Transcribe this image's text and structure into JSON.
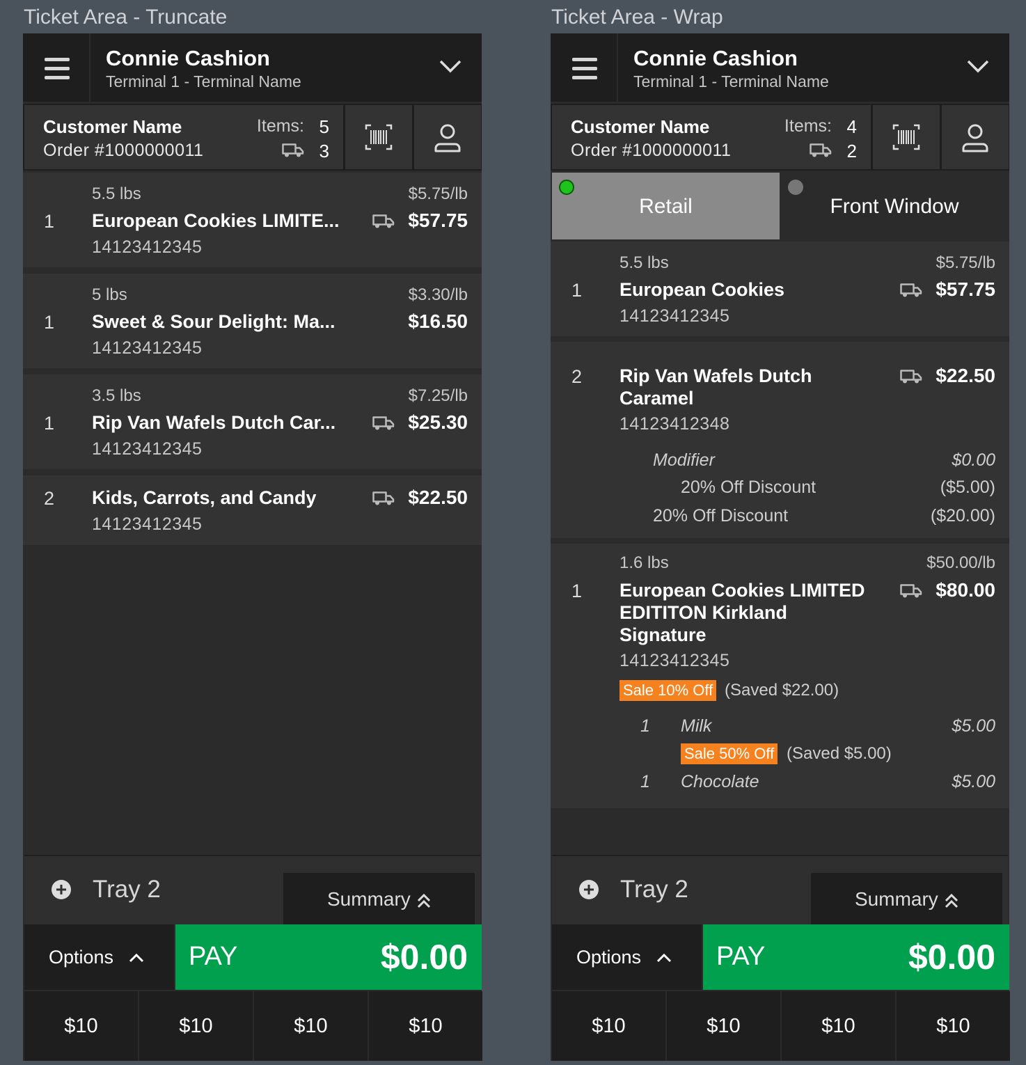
{
  "panels": {
    "left": {
      "label": "Ticket Area - Truncate",
      "header": {
        "cashier": "Connie Cashion",
        "terminal": "Terminal 1 - Terminal Name"
      },
      "customer": {
        "name": "Customer Name",
        "order": "Order #1000000011",
        "items_label": "Items:",
        "items_count": "5",
        "ship_count": "3"
      },
      "lines": [
        {
          "qty": "1",
          "weight": "5.5 lbs",
          "unit_price": "$5.75/lb",
          "name": "European Cookies LIMITE...",
          "sku": "14123412345",
          "price": "$57.75"
        },
        {
          "qty": "1",
          "weight": "5 lbs",
          "unit_price": "$3.30/lb",
          "name": "Sweet & Sour Delight: Ma...",
          "sku": "14123412345",
          "price": "$16.50"
        },
        {
          "qty": "1",
          "weight": "3.5 lbs",
          "unit_price": "$7.25/lb",
          "name": "Rip Van Wafels Dutch Car...",
          "sku": "14123412345",
          "price": "$25.30"
        },
        {
          "qty": "2",
          "name": "Kids, Carrots, and Candy",
          "sku": "14123412345",
          "price": "$22.50"
        }
      ],
      "tray": "Tray 2",
      "summary": "Summary",
      "options": "Options",
      "pay_label": "PAY",
      "pay_amount": "$0.00",
      "quick": [
        "$10",
        "$10",
        "$10",
        "$10"
      ]
    },
    "right": {
      "label": "Ticket Area - Wrap",
      "header": {
        "cashier": "Connie Cashion",
        "terminal": "Terminal 1 - Terminal Name"
      },
      "customer": {
        "name": "Customer Name",
        "order": "Order #1000000011",
        "items_label": "Items:",
        "items_count": "4",
        "ship_count": "2"
      },
      "segments": [
        {
          "label": "Retail",
          "status_color": "#1ec31e"
        },
        {
          "label": "Front Window",
          "status_color": "#777777"
        }
      ],
      "lines": [
        {
          "qty": "1",
          "weight": "5.5 lbs",
          "unit_price": "$5.75/lb",
          "name": "European Cookies",
          "sku": "14123412345",
          "price": "$57.75"
        },
        {
          "qty": "2",
          "name": "Rip Van Wafels Dutch Caramel",
          "sku": "14123412348",
          "price": "$22.50",
          "modifier": {
            "label": "Modifier",
            "price": "$0.00",
            "discount_label": "20% Off Discount",
            "discount_price": "($5.00)"
          },
          "discount": {
            "label": "20% Off Discount",
            "price": "($20.00)"
          }
        },
        {
          "qty": "1",
          "weight": "1.6 lbs",
          "unit_price": "$50.00/lb",
          "name": "European Cookies LIMITED EDITITON Kirkland Signature",
          "sku": "14123412345",
          "price": "$80.00",
          "sale_badge": "Sale 10% Off",
          "saved": "(Saved $22.00)",
          "addons": [
            {
              "qty": "1",
              "name": "Milk",
              "price": "$5.00",
              "sale_badge": "Sale 50% Off",
              "saved": "(Saved $5.00)"
            },
            {
              "qty": "1",
              "name": "Chocolate",
              "price": "$5.00"
            }
          ]
        }
      ],
      "tray": "Tray 2",
      "summary": "Summary",
      "options": "Options",
      "pay_label": "PAY",
      "pay_amount": "$0.00",
      "quick": [
        "$10",
        "$10",
        "$10",
        "$10"
      ]
    }
  },
  "icons": {
    "menu": "hamburger-icon",
    "collapse": "chevron-down-icon",
    "scan": "barcode-icon",
    "customer": "user-icon",
    "ship": "truck-icon",
    "add": "plus-circle-icon",
    "expand": "double-chevron-up-icon",
    "options": "chevron-up-icon"
  },
  "colors": {
    "pay": "#00a04e",
    "sale_badge": "#f5821f",
    "active_status": "#1ec31e"
  }
}
